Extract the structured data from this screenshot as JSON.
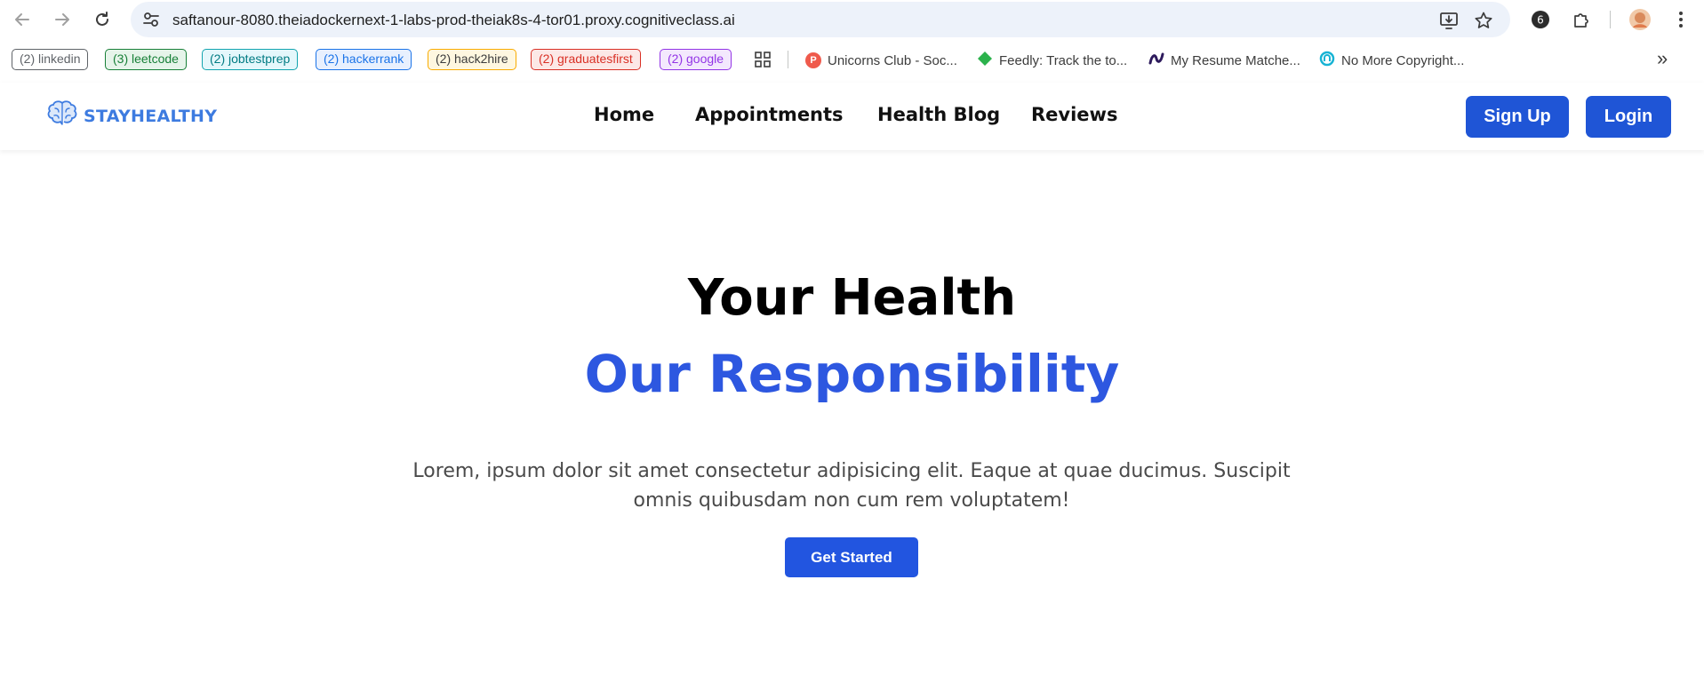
{
  "browser": {
    "url": "saftanour-8080.theiadockernext-1-labs-prod-theiak8s-4-tor01.proxy.cognitiveclass.ai",
    "bookmark_chips": [
      {
        "label": "(2) linkedin",
        "color": "#5f6368",
        "bg": "#ffffff"
      },
      {
        "label": "(3) leetcode",
        "color": "#188038",
        "bg": "#e6f4ea"
      },
      {
        "label": "(2) jobtestprep",
        "color": "#007b83",
        "bg": "#e4f7fb"
      },
      {
        "label": "(2) hackerrank",
        "color": "#1a73e8",
        "bg": "#e8f0fe"
      },
      {
        "label": "(2) hack2hire",
        "color": "#3c3c3c",
        "bg": "#fef7e0",
        "border": "#f9ab00"
      },
      {
        "label": "(2) graduatesfirst",
        "color": "#d93025",
        "bg": "#fce8e6"
      },
      {
        "label": "(2) google",
        "color": "#9334e6",
        "bg": "#f3e8fd"
      }
    ],
    "bookmarks": [
      {
        "label": "Unicorns Club - Soc...",
        "icon": "unicorns-club-icon",
        "color": "#ef5a4c"
      },
      {
        "label": "Feedly: Track the to...",
        "icon": "feedly-icon",
        "color": "#2bb24c"
      },
      {
        "label": "My Resume Matche...",
        "icon": "resume-matcher-icon",
        "color": "#2d1a5c"
      },
      {
        "label": "No More Copyright...",
        "icon": "no-more-copyright-icon",
        "color": "#17b3d4"
      }
    ],
    "more_bookmarks": "»"
  },
  "site": {
    "logo_text": "STAYHEALTHY",
    "nav": [
      "Home",
      "Appointments",
      "Health Blog",
      "Reviews"
    ],
    "signup_label": "Sign Up",
    "login_label": "Login",
    "accent": "#1f55d6"
  },
  "hero": {
    "title_line1": "Your Health",
    "title_line2": "Our Responsibility",
    "description": "Lorem, ipsum dolor sit amet consectetur adipisicing elit. Eaque at quae ducimus. Suscipit omnis quibusdam non cum rem voluptatem!",
    "cta_label": "Get Started",
    "title_color": "#000000",
    "accent": "#2d57e0"
  }
}
